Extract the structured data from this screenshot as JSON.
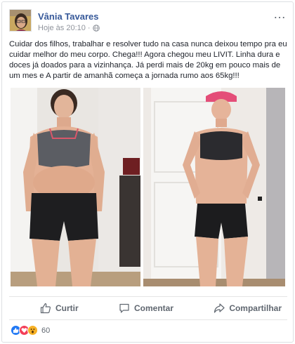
{
  "post": {
    "author": "Vânia Tavares",
    "time": "Hoje às 20:10",
    "separator": "·",
    "text": "Cuidar dos filhos, trabalhar e resolver tudo na casa nunca deixou tempo pra eu cuidar melhor do meu corpo. Chega!!! Agora chegou meu LIVIT. Linha dura e doces já doados para a vizinhança. Já perdi mais de 20kg em pouco mais de um mes e A partir de amanhã começa a jornada rumo aos 65kg!!!",
    "more_icon": "…"
  },
  "actions": {
    "like": "Curtir",
    "comment": "Comentar",
    "share": "Compartilhar"
  },
  "reactions": {
    "count": "60",
    "icons": [
      "like-icon",
      "love-icon",
      "wow-icon"
    ],
    "colors": {
      "like": "#2078f4",
      "love": "#f33e58",
      "wow": "#f7b125"
    }
  },
  "colors": {
    "author": "#365899",
    "meta": "#90949c",
    "action": "#606770"
  }
}
